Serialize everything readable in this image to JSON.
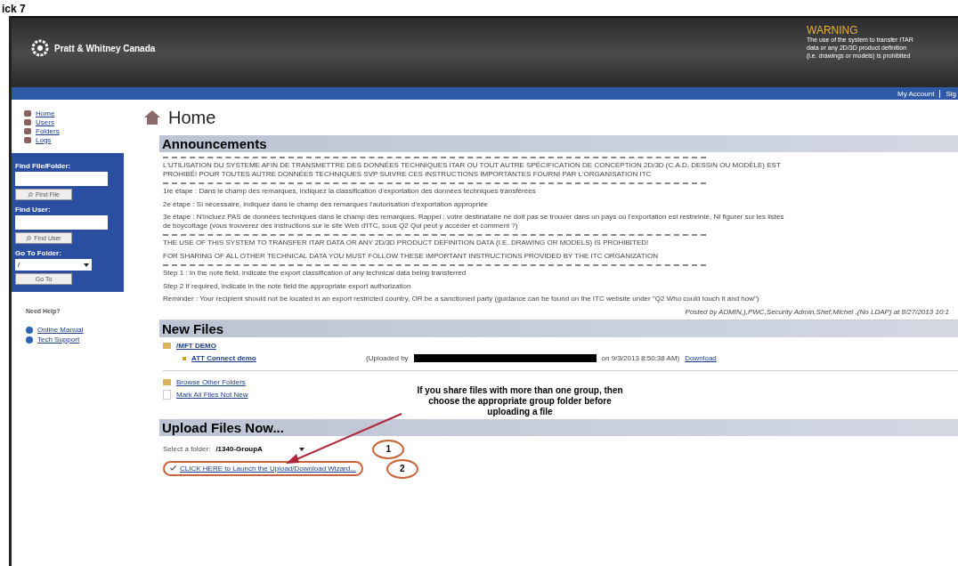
{
  "doc_caption": "ick 7",
  "header": {
    "brand": "Pratt & Whitney Canada",
    "warning_title": "WARNING",
    "warning_lines": [
      "The use of the system to transfer ITAR",
      "data or any 2D/3D product definition",
      "(i.e. drawings or models) is prohibited"
    ]
  },
  "nav_bar": {
    "links": [
      "My Account",
      "Sig"
    ]
  },
  "sidebar": {
    "items": [
      {
        "label": "Home"
      },
      {
        "label": "Users"
      },
      {
        "label": "Folders"
      },
      {
        "label": "Logs"
      }
    ],
    "find_file": {
      "label": "Find File/Folder:",
      "button": "Find File"
    },
    "find_user": {
      "label": "Find User:",
      "button": "Find User"
    },
    "go_to_folder": {
      "label": "Go To Folder:",
      "value": "/",
      "button": "Go To"
    },
    "help": {
      "title": "Need Help?",
      "links": [
        "Online Manual",
        "Tech Support"
      ]
    }
  },
  "page_title": "Home",
  "announcements": {
    "title": "Announcements",
    "items": [
      {
        "kind": "divider"
      },
      {
        "kind": "para",
        "text": "L'UTILISATION DU SYSTEME AFIN DE TRANSMETTRE DES DONNÉES TECHNIQUES ITAR OU TOUT AUTRE SPÉCIFICATION DE CONCEPTION 2D/3D (C.A.D. DESSIN OU MODÈLE) EST PROHIBÉ! POUR TOUTES AUTRE DONNÉES TECHNIQUES SVP SUIVRE CES INSTRUCTIONS IMPORTANTES FOURNI PAR L'ORGANISATION ITC"
      },
      {
        "kind": "divider"
      },
      {
        "kind": "para",
        "text": "1re étape : Dans le champ des remarques, indiquez la classification d'exportation des données techniques transférées"
      },
      {
        "kind": "para",
        "text": "2e étape : Si nécessaire, indiquez dans le champ des remarques l'autorisation d'exportation appropriée"
      },
      {
        "kind": "para",
        "text": "3e étape : N'incluez PAS de données techniques dans le champ des remarques. Rappel : votre destinataire ne doit pas se trouver dans un pays où l'exportation est restreinte, NI figurer sur les listes de boycottage (vous trouverez des instructions sur le site Web d'ITC, sous Q2 Qui peut y accéder et comment ?)"
      },
      {
        "kind": "divider"
      },
      {
        "kind": "para",
        "text": "THE USE OF THIS SYSTEM TO TRANSFER ITAR DATA OR ANY 2D/3D PRODUCT DEFINITION DATA (I.E. DRAWING OR MODELS) IS PROHIBITED!"
      },
      {
        "kind": "para",
        "text": "FOR SHARING OF ALL OTHER TECHNICAL DATA YOU MUST FOLLOW THESE IMPORTANT INSTRUCTIONS PROVIDED BY THE ITC ORGANIZATION"
      },
      {
        "kind": "divider"
      },
      {
        "kind": "para",
        "text": "Step 1 : In the note field, indicate the export classification of any technical data being transferred"
      },
      {
        "kind": "para",
        "text": "Step 2 If required, indicate in the note field the appropriate export authorization"
      },
      {
        "kind": "para",
        "text": "Reminder : Your recipient should not be located in an export restricted country, OR be a sanctioned party (guidance can be found on the ITC website under \"Q2 Who could touch it and how\")"
      }
    ],
    "posted_by": "Posted by ADMIN,),PWC,Security Admin,Shef,Michel ,(No LDAP) at 8/27/2013 10:1"
  },
  "new_files": {
    "title": "New Files",
    "folder": "/MFT DEMO",
    "file": {
      "name": "ATT Connect demo",
      "uploaded_prefix": "(Uploaded by",
      "uploaded_suffix": "on 9/3/2013 8:50:38 AM)",
      "download": "Download"
    },
    "browse": "Browse Other Folders",
    "mark_all": "Mark All Files Not New"
  },
  "callout": "If you share files with more than one group, then choose the appropriate group folder before uploading a file",
  "upload": {
    "title": "Upload Files Now...",
    "select_label": "Select a folder:",
    "select_value": "/1340-GroupA",
    "marker_1": "1",
    "wizard_link": "CLICK HERE to Launch the Upload/Download Wizard...",
    "marker_2": "2"
  }
}
